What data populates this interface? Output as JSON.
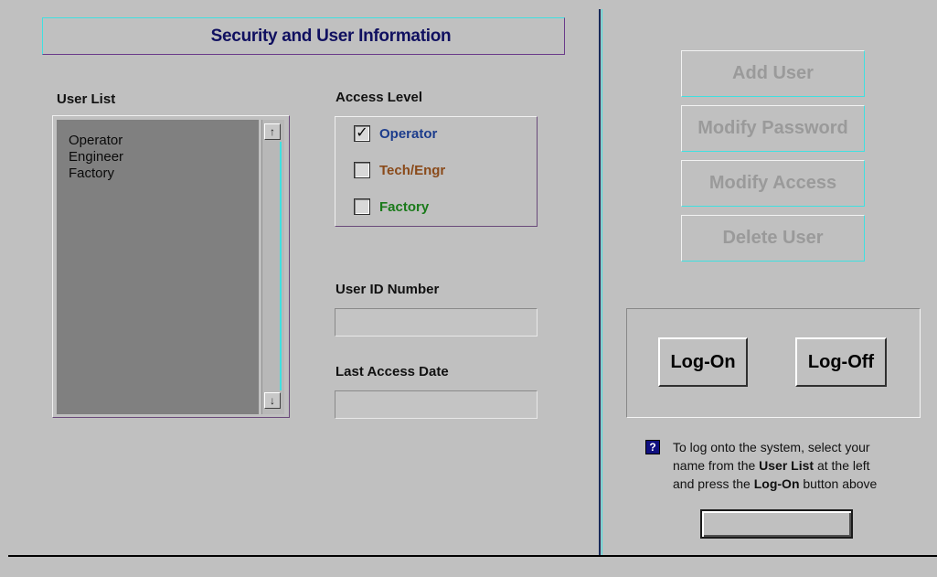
{
  "header": {
    "title": "Security and User Information"
  },
  "user_list": {
    "label": "User List",
    "items": [
      "Operator",
      "Engineer",
      "Factory"
    ],
    "scroll_up_icon": "arrow-up-icon",
    "scroll_down_icon": "arrow-down-icon"
  },
  "access_level": {
    "label": "Access Level",
    "options": [
      {
        "label": "Operator",
        "checked": true,
        "color": "#1c3c8c"
      },
      {
        "label": "Tech/Engr",
        "checked": false,
        "color": "#8a4a1a"
      },
      {
        "label": "Factory",
        "checked": false,
        "color": "#1a7a1a"
      }
    ]
  },
  "user_id": {
    "label": "User ID Number",
    "value": ""
  },
  "last_access": {
    "label": "Last Access Date",
    "value": ""
  },
  "actions": {
    "add_user": "Add User",
    "modify_password": "Modify Password",
    "modify_access": "Modify Access",
    "delete_user": "Delete User"
  },
  "session": {
    "logon": "Log-On",
    "logoff": "Log-Off"
  },
  "help": {
    "icon": "help-icon",
    "line1": "To log onto the system, select your",
    "line2_pre": "name from the ",
    "line2_bold": "User List",
    "line2_post": " at the left",
    "line3_pre": "and press the ",
    "line3_bold": "Log-On",
    "line3_post": " button above"
  },
  "colors": {
    "background": "#c0c0c0",
    "list_background": "#808080",
    "accent_cyan": "#40e0e0",
    "title_text": "#101060",
    "disabled_text": "#9a9a9a"
  }
}
